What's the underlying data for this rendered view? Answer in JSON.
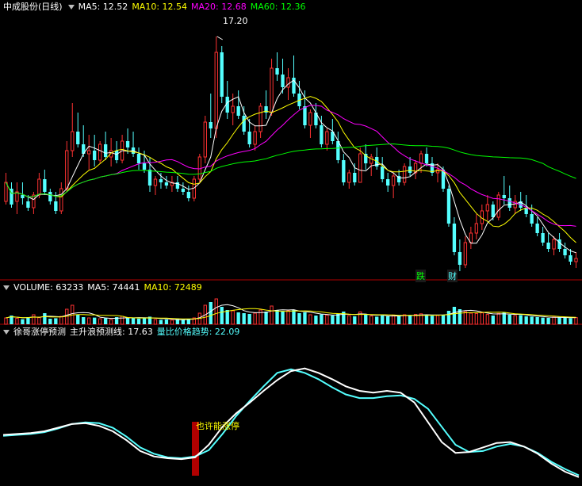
{
  "main": {
    "title": "中成股份(日线)",
    "ma5": "MA5: 12.52",
    "ma10": "MA10: 12.54",
    "ma20": "MA20: 12.68",
    "ma60": "MA60: 12.36",
    "peak_label": "17.20",
    "badge_1": "跌",
    "badge_2": "财"
  },
  "volume_panel": {
    "title": "VOLUME: 63233",
    "ma5": "MA5: 74441",
    "ma10": "MA10: 72489"
  },
  "indicator_panel": {
    "title": "徐哥涨停预测",
    "line1": "主升浪预测线: 17.63",
    "line2": "量比价格趋势: 22.09",
    "signal_label": "也许能涨停"
  },
  "colors": {
    "up": "#ff3232",
    "down": "#54ffff",
    "ma5": "#ffffff",
    "ma10": "#ffff00",
    "ma20": "#ff00ff",
    "ma60": "#00ff00",
    "separator": "#b00000",
    "signal_bar": "#b00000"
  },
  "chart_data": [
    {
      "type": "candlestick",
      "title": "中成股份(日线)",
      "ylim": [
        9.6,
        17.9
      ],
      "candles": [
        [
          12.0,
          12.9,
          11.9,
          12.6
        ],
        [
          12.4,
          12.6,
          11.8,
          11.9
        ],
        [
          12.0,
          12.6,
          11.6,
          12.3
        ],
        [
          12.2,
          12.6,
          11.9,
          12.1
        ],
        [
          12.0,
          12.2,
          11.7,
          11.8
        ],
        [
          11.8,
          12.3,
          11.6,
          12.2
        ],
        [
          12.2,
          12.9,
          12.1,
          12.7
        ],
        [
          12.7,
          13.0,
          12.2,
          12.3
        ],
        [
          12.3,
          12.4,
          11.9,
          12.0
        ],
        [
          12.0,
          12.3,
          11.6,
          11.7
        ],
        [
          11.7,
          12.6,
          11.6,
          12.4
        ],
        [
          12.4,
          13.9,
          12.3,
          13.6
        ],
        [
          13.6,
          15.1,
          13.4,
          14.2
        ],
        [
          14.2,
          14.8,
          13.7,
          13.8
        ],
        [
          13.8,
          14.4,
          13.4,
          13.5
        ],
        [
          13.5,
          14.1,
          13.0,
          13.6
        ],
        [
          13.6,
          14.1,
          13.1,
          13.3
        ],
        [
          13.3,
          13.9,
          13.2,
          13.8
        ],
        [
          13.8,
          14.2,
          13.3,
          13.4
        ],
        [
          13.4,
          14.0,
          13.1,
          13.6
        ],
        [
          13.6,
          13.9,
          13.2,
          13.3
        ],
        [
          13.3,
          14.1,
          13.2,
          13.9
        ],
        [
          13.9,
          14.3,
          13.5,
          13.7
        ],
        [
          13.7,
          14.2,
          13.4,
          13.5
        ],
        [
          13.5,
          13.7,
          13.0,
          13.2
        ],
        [
          13.2,
          13.6,
          12.9,
          13.0
        ],
        [
          13.0,
          13.4,
          12.3,
          12.5
        ],
        [
          12.5,
          12.8,
          12.2,
          12.7
        ],
        [
          12.7,
          12.9,
          12.4,
          12.6
        ],
        [
          12.6,
          12.8,
          12.4,
          12.5
        ],
        [
          12.5,
          12.8,
          12.3,
          12.6
        ],
        [
          12.6,
          12.8,
          12.3,
          12.4
        ],
        [
          12.4,
          12.6,
          12.2,
          12.3
        ],
        [
          12.3,
          12.5,
          12.0,
          12.1
        ],
        [
          12.1,
          12.8,
          12.0,
          12.7
        ],
        [
          12.7,
          13.5,
          12.6,
          13.4
        ],
        [
          13.4,
          14.7,
          13.2,
          14.5
        ],
        [
          14.5,
          15.4,
          14.0,
          14.3
        ],
        [
          14.3,
          17.2,
          14.0,
          16.7
        ],
        [
          16.7,
          16.9,
          15.1,
          15.3
        ],
        [
          15.3,
          15.8,
          14.6,
          14.8
        ],
        [
          14.8,
          15.4,
          14.4,
          15.0
        ],
        [
          15.0,
          15.5,
          14.6,
          14.7
        ],
        [
          14.7,
          15.0,
          14.1,
          14.2
        ],
        [
          14.2,
          14.6,
          13.7,
          13.8
        ],
        [
          13.8,
          14.4,
          13.6,
          14.2
        ],
        [
          14.2,
          15.1,
          14.0,
          15.0
        ],
        [
          15.0,
          15.5,
          14.6,
          14.8
        ],
        [
          14.8,
          16.5,
          14.7,
          16.2
        ],
        [
          16.2,
          16.7,
          15.8,
          16.0
        ],
        [
          16.0,
          16.5,
          15.4,
          15.6
        ],
        [
          15.6,
          16.2,
          15.2,
          15.9
        ],
        [
          15.9,
          16.6,
          15.3,
          15.4
        ],
        [
          15.4,
          15.8,
          14.9,
          15.0
        ],
        [
          15.0,
          15.5,
          14.3,
          14.4
        ],
        [
          14.4,
          14.9,
          14.0,
          14.8
        ],
        [
          14.8,
          15.1,
          14.3,
          14.4
        ],
        [
          14.4,
          14.7,
          13.7,
          13.8
        ],
        [
          13.8,
          14.3,
          13.6,
          14.2
        ],
        [
          14.2,
          14.6,
          13.8,
          13.9
        ],
        [
          13.9,
          14.2,
          13.2,
          13.3
        ],
        [
          13.3,
          13.5,
          12.5,
          12.6
        ],
        [
          12.6,
          13.0,
          12.4,
          12.9
        ],
        [
          12.9,
          13.2,
          12.5,
          12.6
        ],
        [
          12.6,
          13.7,
          12.6,
          13.5
        ],
        [
          13.5,
          13.8,
          13.0,
          13.2
        ],
        [
          13.2,
          13.5,
          12.8,
          13.4
        ],
        [
          13.4,
          13.7,
          13.0,
          13.1
        ],
        [
          13.1,
          13.4,
          12.6,
          12.7
        ],
        [
          12.7,
          12.9,
          12.3,
          12.5
        ],
        [
          12.5,
          12.9,
          12.1,
          12.8
        ],
        [
          12.8,
          13.0,
          12.5,
          12.6
        ],
        [
          12.6,
          13.2,
          12.5,
          13.1
        ],
        [
          13.1,
          13.4,
          12.8,
          12.9
        ],
        [
          12.9,
          13.3,
          12.7,
          13.2
        ],
        [
          13.2,
          13.6,
          12.9,
          13.5
        ],
        [
          13.5,
          13.7,
          13.1,
          13.2
        ],
        [
          13.2,
          13.4,
          12.8,
          12.9
        ],
        [
          12.9,
          13.2,
          12.6,
          13.0
        ],
        [
          13.0,
          13.1,
          12.3,
          12.4
        ],
        [
          12.4,
          12.5,
          11.2,
          11.3
        ],
        [
          11.3,
          11.5,
          10.3,
          10.4
        ],
        [
          10.4,
          10.8,
          9.8,
          10.0
        ],
        [
          10.0,
          10.9,
          9.9,
          10.7
        ],
        [
          10.7,
          11.2,
          10.5,
          11.0
        ],
        [
          11.0,
          11.6,
          10.8,
          11.3
        ],
        [
          11.3,
          11.9,
          11.1,
          11.7
        ],
        [
          11.7,
          12.2,
          11.4,
          11.9
        ],
        [
          11.9,
          12.0,
          11.4,
          11.5
        ],
        [
          11.5,
          12.3,
          11.4,
          12.2
        ],
        [
          12.2,
          12.8,
          11.9,
          12.1
        ],
        [
          12.1,
          12.5,
          11.7,
          11.8
        ],
        [
          11.8,
          12.2,
          11.6,
          12.0
        ],
        [
          12.0,
          12.3,
          11.7,
          11.8
        ],
        [
          11.8,
          12.2,
          11.5,
          11.6
        ],
        [
          11.6,
          11.9,
          11.2,
          11.3
        ],
        [
          11.3,
          11.5,
          10.9,
          11.0
        ],
        [
          11.0,
          11.2,
          10.6,
          10.7
        ],
        [
          10.7,
          11.0,
          10.4,
          10.5
        ],
        [
          10.5,
          10.9,
          10.3,
          10.8
        ],
        [
          10.8,
          11.0,
          10.4,
          10.5
        ],
        [
          10.5,
          10.7,
          10.2,
          10.3
        ],
        [
          10.3,
          10.5,
          10.0,
          10.1
        ],
        [
          10.1,
          10.4,
          9.9,
          10.2
        ]
      ]
    },
    {
      "type": "bar",
      "title": "VOLUME: 63233",
      "values": [
        40,
        55,
        38,
        32,
        45,
        60,
        42,
        70,
        35,
        38,
        50,
        95,
        120,
        60,
        45,
        40,
        42,
        35,
        38,
        30,
        45,
        50,
        40,
        38,
        36,
        40,
        48,
        30,
        28,
        30,
        26,
        32,
        30,
        35,
        40,
        70,
        120,
        140,
        160,
        110,
        90,
        85,
        75,
        70,
        65,
        70,
        90,
        80,
        115,
        90,
        80,
        85,
        90,
        70,
        75,
        60,
        55,
        62,
        58,
        55,
        65,
        80,
        55,
        50,
        78,
        60,
        52,
        48,
        55,
        50,
        58,
        52,
        60,
        55,
        62,
        66,
        58,
        54,
        56,
        60,
        85,
        110,
        95,
        80,
        70,
        68,
        72,
        62,
        55,
        68,
        75,
        60,
        55,
        58,
        50,
        48,
        45,
        42,
        40,
        46,
        44,
        40,
        38,
        42
      ],
      "ylim": [
        0,
        200
      ]
    },
    {
      "type": "line",
      "title": "徐哥涨停预测",
      "series": [
        {
          "name": "主升浪预测线",
          "values": [
            5.6,
            5.7,
            5.8,
            6.0,
            6.4,
            6.8,
            6.9,
            6.6,
            6.0,
            5.0,
            3.8,
            3.2,
            3.0,
            2.9,
            3.1,
            4.5,
            6.5,
            8.0,
            9.2,
            10.5,
            11.7,
            12.7,
            13.0,
            12.5,
            11.8,
            11.0,
            10.5,
            10.3,
            10.5,
            10.3,
            9.2,
            7.0,
            4.8,
            3.6,
            3.7,
            4.2,
            4.7,
            4.8,
            4.3,
            3.5,
            2.4,
            1.5,
            0.9
          ]
        },
        {
          "name": "量比价格趋势",
          "values": [
            5.5,
            5.6,
            5.7,
            5.9,
            6.3,
            6.8,
            7.0,
            6.9,
            6.4,
            5.4,
            4.2,
            3.5,
            3.1,
            3.0,
            3.2,
            3.9,
            5.7,
            7.7,
            9.4,
            11.0,
            12.5,
            12.9,
            12.5,
            11.8,
            10.9,
            10.1,
            9.7,
            9.7,
            9.9,
            10.0,
            9.6,
            8.5,
            6.5,
            4.5,
            3.7,
            3.8,
            4.3,
            4.6,
            4.3,
            3.6,
            2.6,
            1.8,
            1.1
          ]
        }
      ],
      "ylim": [
        0,
        16.5
      ],
      "annotations": [
        "也许能涨停"
      ]
    }
  ]
}
